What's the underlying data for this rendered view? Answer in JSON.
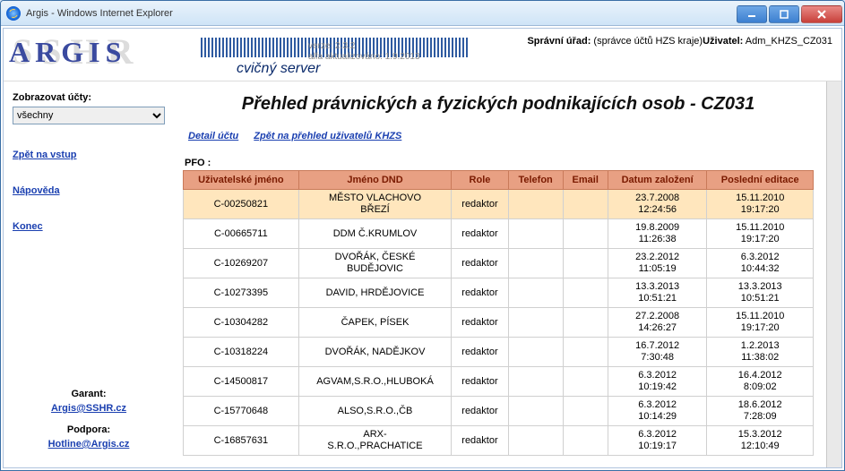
{
  "window": {
    "title": "Argis - Windows Internet Explorer"
  },
  "header": {
    "logo_bg": "SSHR",
    "logo_fg": "ARGIS",
    "version_line1": "verze: 2.3.2",
    "version_line2": "alfa aktualizováno: 1.9.2013",
    "cvicny": "cvičný server",
    "spravni_label": "Správní úřad:",
    "spravni_value": "(správce účtů HZS kraje)",
    "uzivatel_label": "Uživatel:",
    "uzivatel_value": "Adm_KHZS_CZ031"
  },
  "sidebar": {
    "filter_label": "Zobrazovat účty:",
    "filter_value": "všechny",
    "links": {
      "zpet": "Zpět na vstup",
      "napoveda": "Nápověda",
      "konec": "Konec"
    },
    "garant_label": "Garant:",
    "garant_email": "Argis@SSHR.cz",
    "podpora_label": "Podpora:",
    "podpora_email": "Hotline@Argis.cz"
  },
  "main": {
    "title": "Přehled právnických a fyzických podnikajících osob - CZ031",
    "link_detail": "Detail účtu",
    "link_zpet": "Zpět na přehled uživatelů KHZS",
    "section": "PFO :",
    "columns": {
      "c0": "Uživatelské jméno",
      "c1": "Jméno DND",
      "c2": "Role",
      "c3": "Telefon",
      "c4": "Email",
      "c5": "Datum založení",
      "c6": "Poslední editace"
    },
    "rows": [
      {
        "user": "C-00250821",
        "dnd": "MĚSTO VLACHOVO BŘEZÍ",
        "role": "redaktor",
        "tel": "",
        "email": "",
        "created": "23.7.2008 12:24:56",
        "edited": "15.11.2010 19:17:20",
        "hl": true
      },
      {
        "user": "C-00665711",
        "dnd": "DDM Č.KRUMLOV",
        "role": "redaktor",
        "tel": "",
        "email": "",
        "created": "19.8.2009 11:26:38",
        "edited": "15.11.2010 19:17:20"
      },
      {
        "user": "C-10269207",
        "dnd": "DVOŘÁK, ČESKÉ BUDĚJOVIC",
        "role": "redaktor",
        "tel": "",
        "email": "",
        "created": "23.2.2012 11:05:19",
        "edited": "6.3.2012 10:44:32"
      },
      {
        "user": "C-10273395",
        "dnd": "DAVID, HRDĚJOVICE",
        "role": "redaktor",
        "tel": "",
        "email": "",
        "created": "13.3.2013 10:51:21",
        "edited": "13.3.2013 10:51:21"
      },
      {
        "user": "C-10304282",
        "dnd": "ČAPEK, PÍSEK",
        "role": "redaktor",
        "tel": "",
        "email": "",
        "created": "27.2.2008 14:26:27",
        "edited": "15.11.2010 19:17:20"
      },
      {
        "user": "C-10318224",
        "dnd": "DVOŘÁK, NADĚJKOV",
        "role": "redaktor",
        "tel": "",
        "email": "",
        "created": "16.7.2012 7:30:48",
        "edited": "1.2.2013 11:38:02"
      },
      {
        "user": "C-14500817",
        "dnd": "AGVAM,S.R.O.,HLUBOKÁ",
        "role": "redaktor",
        "tel": "",
        "email": "",
        "created": "6.3.2012 10:19:42",
        "edited": "16.4.2012 8:09:02"
      },
      {
        "user": "C-15770648",
        "dnd": "ALSO,S.R.O.,ČB",
        "role": "redaktor",
        "tel": "",
        "email": "",
        "created": "6.3.2012 10:14:29",
        "edited": "18.6.2012 7:28:09"
      },
      {
        "user": "C-16857631",
        "dnd": "ARX-S.R.O.,PRACHATICE",
        "role": "redaktor",
        "tel": "",
        "email": "",
        "created": "6.3.2012 10:19:17",
        "edited": "15.3.2012 12:10:49"
      }
    ]
  }
}
